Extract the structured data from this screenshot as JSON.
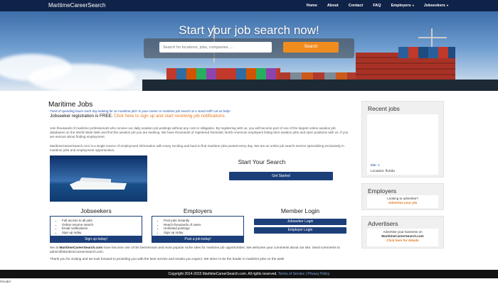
{
  "navbar": {
    "brand": "MaritimeCareerSearch",
    "items": [
      "Home",
      "About",
      "Contact",
      "FAQ",
      "Employers",
      "Jobseekers"
    ]
  },
  "hero": {
    "title": "Start your job search now!",
    "search_placeholder": "Search for locations, jobs, companies, ...",
    "search_button": "Search"
  },
  "main": {
    "heading": "Maritime Jobs",
    "tagline": "Tired of spending hours each day looking for an maritime job? Is your career or maritime job search at a stand still? Let us help!",
    "free_text": "Jobseeker registration is FREE.",
    "free_link": "Click here to sign up and start receiving job notifications.",
    "para1": "Join thousands of maritime professionals who receive our daily aviation job postings without any cost or obligation. By registering with us, you will become part of one of the largest online aviation job databases on the World Wide Web and find the aviation job you are seeking. We have thousands of registered Domestic North American employers listing their aviation jobs and open positions with us. If you are serious about finding employment.",
    "para2": "MaritimeCareerSearch.com is a single source of employment information with many exciting and hard to find maritime jobs posted every day. We are an online job search service specializing exclusively in maritime jobs and employment opportunities.",
    "start_title": "Start Your Search",
    "get_started": "Get Started"
  },
  "jobseekers": {
    "title": "Jobseekers",
    "items": [
      "Full access to all jobs",
      "Online resume search",
      "Email notifications",
      "Sign up today"
    ],
    "button": "Sign up today!"
  },
  "employers_col": {
    "title": "Employers",
    "items": [
      "Post jobs instantly",
      "Reach thousands of users",
      "Unlimited postings",
      "Sign up today"
    ],
    "button": "Post a job today!"
  },
  "member_login": {
    "title": "Member Login",
    "jobseeker_button": "Jobseeker Login",
    "employer_button": "Employer Login"
  },
  "bottom": {
    "para1_prefix": "We at",
    "para1_bold": "MaritimeCareerSearch.com",
    "para1_rest": "have become one of the best-known and most popular niche sites for maritime job opportunities. We welcome your comments about our site. Send comments to admin@MaritimeCareerSearch.com.",
    "para2": "Thank you for visiting and we look forward to providing you with the best service and results you expect. We strive to be the leader in maritime jobs on the web!"
  },
  "sidebar": {
    "recent_title": "Recent jobs",
    "recent_job_title": "title: 1",
    "recent_job_location": "Location: florida",
    "employers_title": "Employers",
    "employers_text": "Looking to advertise?",
    "employers_link": "Advertise your job",
    "advertisers_title": "Advertisers",
    "advertisers_text": "Advertise your business on",
    "advertisers_site": "MaritimeCareerSearch.com",
    "advertisers_link": "Click here for details"
  },
  "footer": {
    "copyright": "Copyright 2014-2015 MaritimeCareerSearch.com. All rights reserved.",
    "terms": "Terms of Service",
    "separator": "|",
    "privacy": "Privacy Policy"
  },
  "model_tag": "#model",
  "colors": {
    "navbar": "#0f2247",
    "accent_orange": "#f08c1e",
    "button_blue": "#1c3f7a",
    "link_orange": "#e07820",
    "tagline_blue": "#1a4fa6"
  }
}
